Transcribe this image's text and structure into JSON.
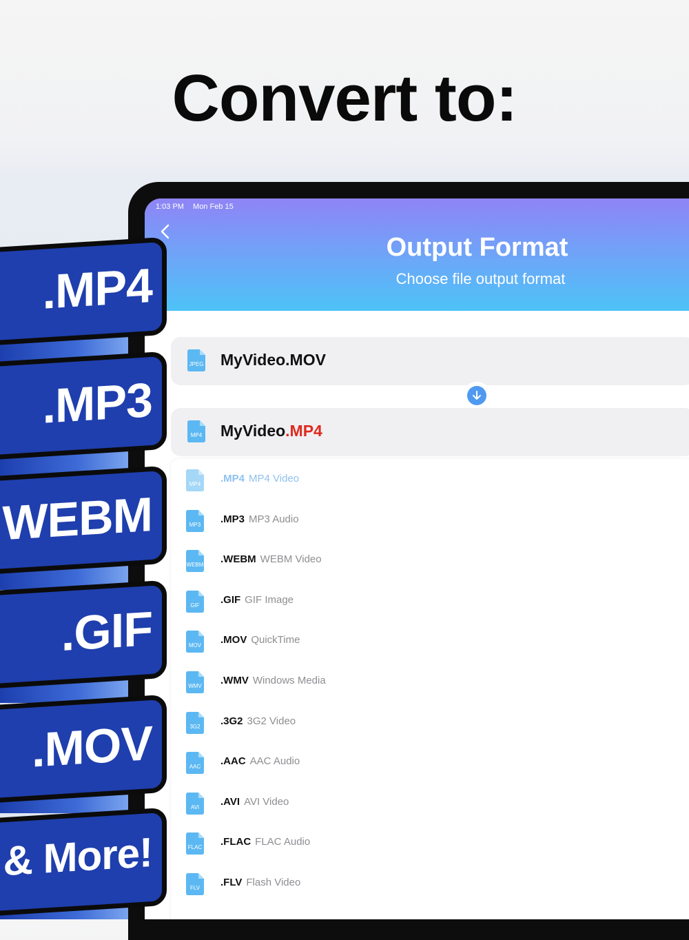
{
  "headline": "Convert to:",
  "status": {
    "time": "1:03 PM",
    "date": "Mon Feb 15"
  },
  "header": {
    "title": "Output Format",
    "subtitle": "Choose file output format"
  },
  "source_file": {
    "name": "MyVideo.MOV",
    "icon_label": "JPEG"
  },
  "target_file": {
    "base": "MyVideo",
    "ext": ".MP4",
    "icon_label": "MP4"
  },
  "formats": [
    {
      "ext": ".MP4",
      "desc": "MP4 Video",
      "icon": "MP4",
      "selected": true
    },
    {
      "ext": ".MP3",
      "desc": "MP3 Audio",
      "icon": "MP3"
    },
    {
      "ext": ".WEBM",
      "desc": "WEBM Video",
      "icon": "WEBM"
    },
    {
      "ext": ".GIF",
      "desc": "GIF Image",
      "icon": "GIF"
    },
    {
      "ext": ".MOV",
      "desc": "QuickTime",
      "icon": "MOV"
    },
    {
      "ext": ".WMV",
      "desc": "Windows Media",
      "icon": "WMV"
    },
    {
      "ext": ".3G2",
      "desc": "3G2 Video",
      "icon": "3G2"
    },
    {
      "ext": ".AAC",
      "desc": "AAC Audio",
      "icon": "AAC"
    },
    {
      "ext": ".AVI",
      "desc": "AVI Video",
      "icon": "AVI"
    },
    {
      "ext": ".FLAC",
      "desc": "FLAC Audio",
      "icon": "FLAC"
    },
    {
      "ext": ".FLV",
      "desc": "Flash Video",
      "icon": "FLV"
    }
  ],
  "badges": [
    ".MP4",
    ".MP3",
    ".WEBM",
    ".GIF",
    ".MOV",
    "& More!"
  ],
  "colors": {
    "header_top": "#8f84f6",
    "header_bottom": "#4dc3f7",
    "badge": "#1f3fae",
    "accent_red": "#e0291e",
    "icon_blue": "#5cb8f2"
  }
}
